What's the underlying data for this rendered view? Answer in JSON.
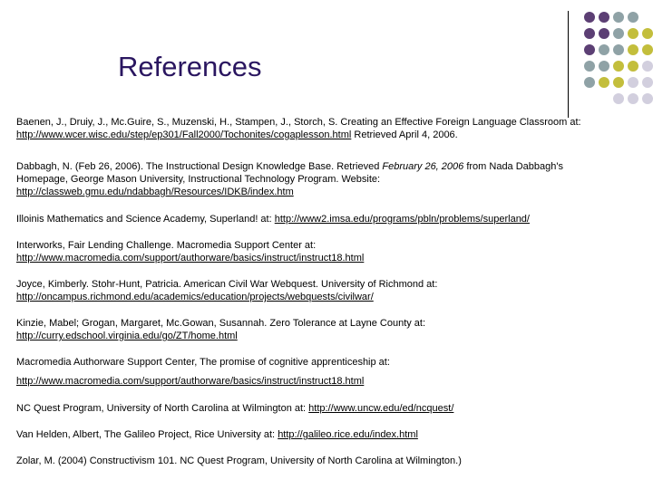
{
  "title": "References",
  "colors": {
    "title": "#2a1660",
    "dot_purple": "#5c3f74",
    "dot_teal": "#8fa2a6",
    "dot_olive": "#c3be3c",
    "dot_lavender": "#d2cfde"
  },
  "references": [
    {
      "text": "Baenen, J., Druiy, J., Mc.Guire, S., Muzenski, H., Stampen, J., Storch, S. Creating an Effective Foreign Language Classroom at:",
      "url": "http://www.wcer.wisc.edu/step/ep301/Fall2000/Tochonites/cogaplesson.html",
      "after": " Retrieved April 4, 2006."
    },
    {
      "line1": "Dabbagh, N. (Feb 26, 2006). The Instructional Design Knowledge Base. Retrieved ",
      "date": "February 26, 2006",
      "line1_after": " from Nada Dabbagh's",
      "line2": "Homepage, George Mason University, Instructional Technology Program. Website:",
      "url": "http://classweb.gmu.edu/ndabbagh/Resources/IDKB/index.htm"
    },
    {
      "text": "Illoinis Mathematics and Science Academy, Superland! at:",
      "url": "http://www2.imsa.edu/programs/pbln/problems/superland/"
    },
    {
      "text": "Interworks, Fair Lending Challenge. Macromedia Support Center at:",
      "url": "http://www.macromedia.com/support/authorware/basics/instruct/instruct18.html"
    },
    {
      "text": "Joyce, Kimberly. Stohr-Hunt, Patricia. American Civil War Webquest. University of Richmond at:",
      "url": "http://oncampus.richmond.edu/academics/education/projects/webquests/civilwar/"
    },
    {
      "text": "Kinzie, Mabel; Grogan, Margaret, Mc.Gowan, Susannah.  Zero Tolerance at Layne County at:",
      "url": "http://curry.edschool.virginia.edu/go/ZT/home.html"
    },
    {
      "text": "Macromedia Authorware Support Center, The promise of cognitive apprenticeship at:",
      "url": "http://www.macromedia.com/support/authorware/basics/instruct/instruct18.html"
    },
    {
      "text": "NC Quest Program, University of North Carolina at Wilmington at:",
      "url": "http://www.uncw.edu/ed/ncquest/"
    },
    {
      "text": "Van Helden, Albert, The Galileo Project, Rice University at:",
      "url": "http://galileo.rice.edu/index.html"
    },
    {
      "text": "Zolar, M. (2004) Constructivism 101. NC Quest Program, University of North Carolina at Wilmington.)"
    }
  ]
}
